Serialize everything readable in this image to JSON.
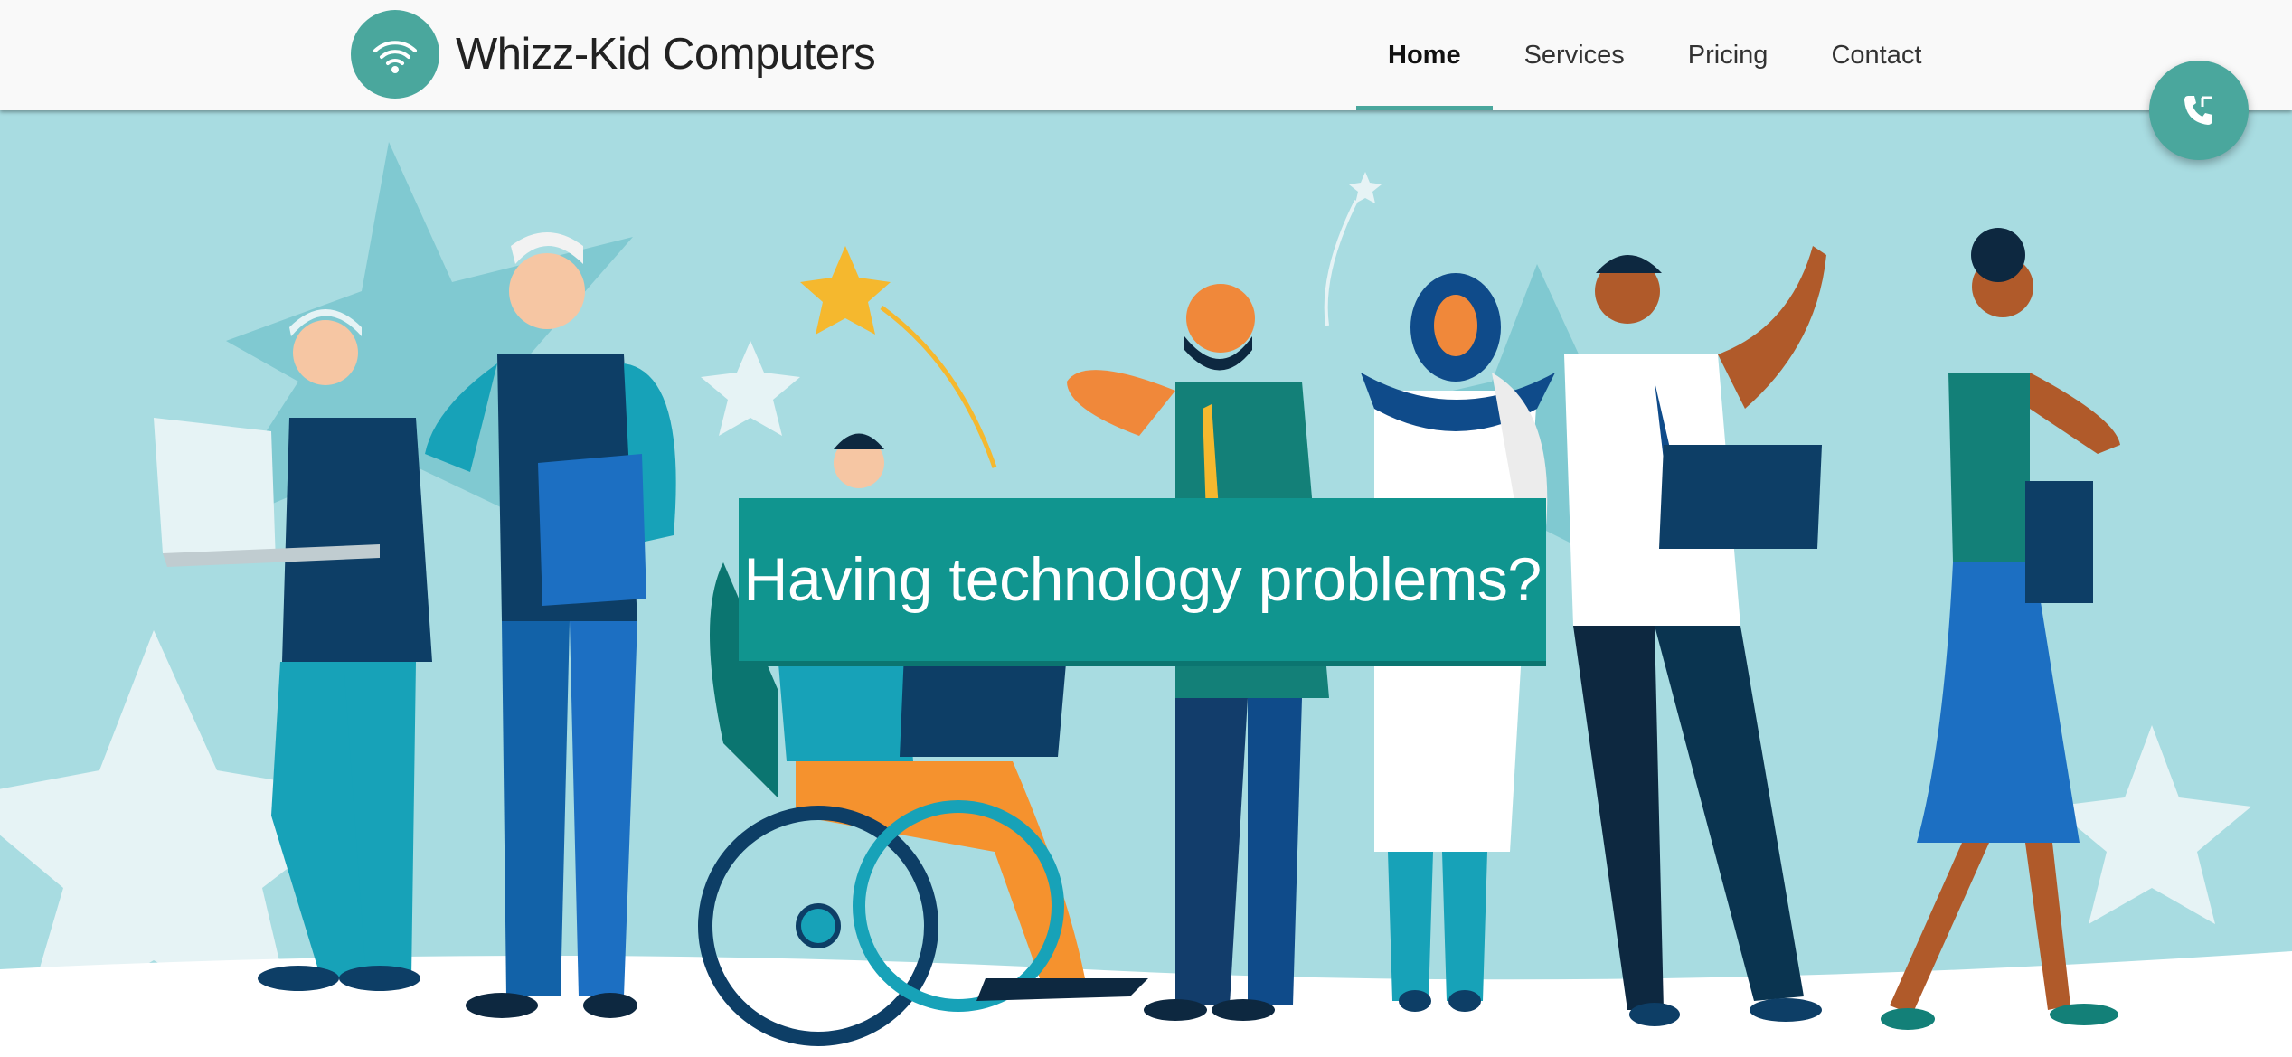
{
  "brand": {
    "name": "Whizz-Kid Computers",
    "logo_icon": "wifi-icon"
  },
  "nav": {
    "items": [
      {
        "label": "Home",
        "active": true
      },
      {
        "label": "Services",
        "active": false
      },
      {
        "label": "Pricing",
        "active": false
      },
      {
        "label": "Contact",
        "active": false
      }
    ]
  },
  "hero": {
    "headline": "Having technology problems?",
    "illustration": "people-with-devices-illustration"
  },
  "call_button": {
    "icon": "phone-icon"
  },
  "colors": {
    "accent": "#4aa79d",
    "hero_background": "#a8dce1",
    "headline_box": "#10958f",
    "text": "#222222"
  }
}
